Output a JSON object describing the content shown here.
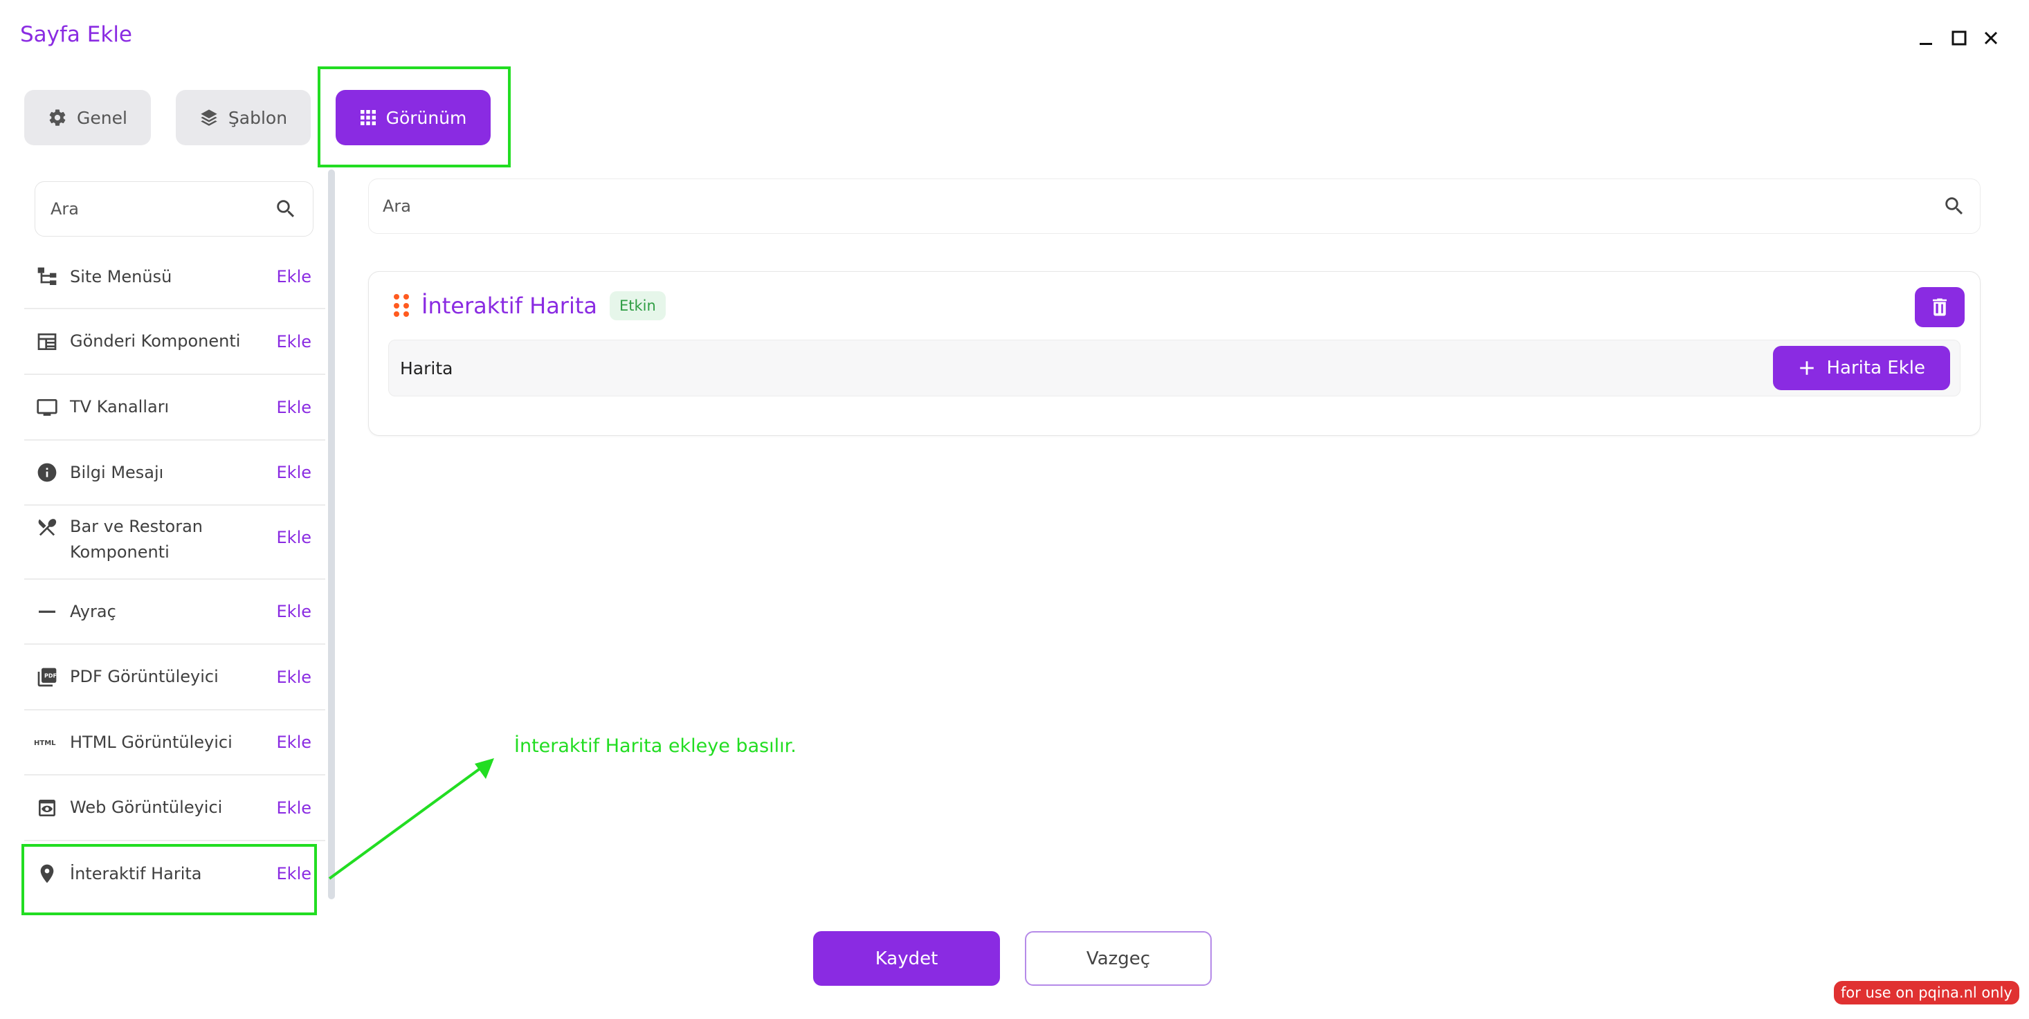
{
  "window": {
    "title": "Sayfa Ekle"
  },
  "tabs": [
    {
      "label": "Genel",
      "icon": "gear-icon",
      "active": false
    },
    {
      "label": "Şablon",
      "icon": "layers-icon",
      "active": false
    },
    {
      "label": "Görünüm",
      "icon": "grid-icon",
      "active": true
    }
  ],
  "left_panel": {
    "search_placeholder": "Ara",
    "items": [
      {
        "label": "Site Menüsü",
        "add": "Ekle",
        "icon": "sitemap-icon"
      },
      {
        "label": "Gönderi Komponenti",
        "add": "Ekle",
        "icon": "post-icon"
      },
      {
        "label": "TV Kanalları",
        "add": "Ekle",
        "icon": "tv-icon"
      },
      {
        "label": "Bilgi Mesajı",
        "add": "Ekle",
        "icon": "info-icon"
      },
      {
        "label": "Bar ve Restoran Komponenti",
        "add": "Ekle",
        "icon": "utensils-icon"
      },
      {
        "label": "Ayraç",
        "add": "Ekle",
        "icon": "divider-icon"
      },
      {
        "label": "PDF Görüntüleyici",
        "add": "Ekle",
        "icon": "pdf-icon"
      },
      {
        "label": "HTML Görüntüleyici",
        "add": "Ekle",
        "icon": "html-icon"
      },
      {
        "label": "Web Görüntüleyici",
        "add": "Ekle",
        "icon": "web-view-icon"
      },
      {
        "label": "İnteraktif Harita",
        "add": "Ekle",
        "icon": "map-pin-icon"
      }
    ]
  },
  "right_panel": {
    "search_placeholder": "Ara",
    "component": {
      "title": "İnteraktif Harita",
      "status": "Etkin",
      "row_label": "Harita",
      "add_button": "Harita Ekle"
    }
  },
  "annotation": {
    "text": "İnteraktif Harita ekleye basılır.",
    "color": "#22dd22"
  },
  "footer": {
    "save": "Kaydet",
    "cancel": "Vazgeç"
  },
  "watermark": "for use on pqina.nl only",
  "colors": {
    "accent": "#8a2be2",
    "highlight": "#22dd22",
    "success_bg": "#e6f6ea",
    "success_text": "#2f9e44",
    "drag_handle": "#ff5a1f"
  }
}
